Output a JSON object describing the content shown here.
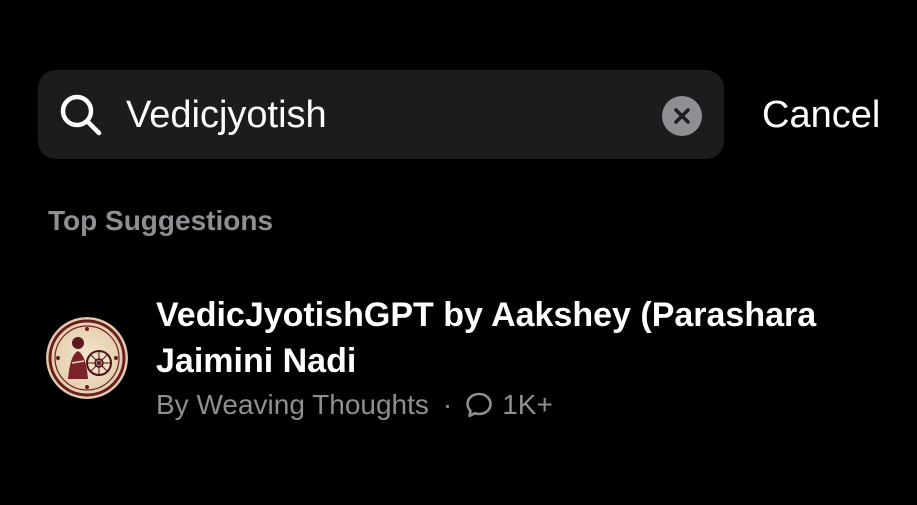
{
  "colors": {
    "background": "#000000",
    "search_bg": "#1c1c1e",
    "secondary_text": "#8e8e93",
    "primary_text": "#ffffff"
  },
  "search": {
    "value": "Vedicjyotish",
    "icon": "search-icon",
    "clear_icon": "clear-icon"
  },
  "cancel_label": "Cancel",
  "section_title": "Top Suggestions",
  "results": [
    {
      "title": "VedicJyotishGPT by Aakshey (Parashara Jaimini Nadi",
      "author": "By Weaving Thoughts",
      "separator": "·",
      "conversations": "1K+",
      "conversation_icon": "chat-bubble-icon"
    }
  ]
}
